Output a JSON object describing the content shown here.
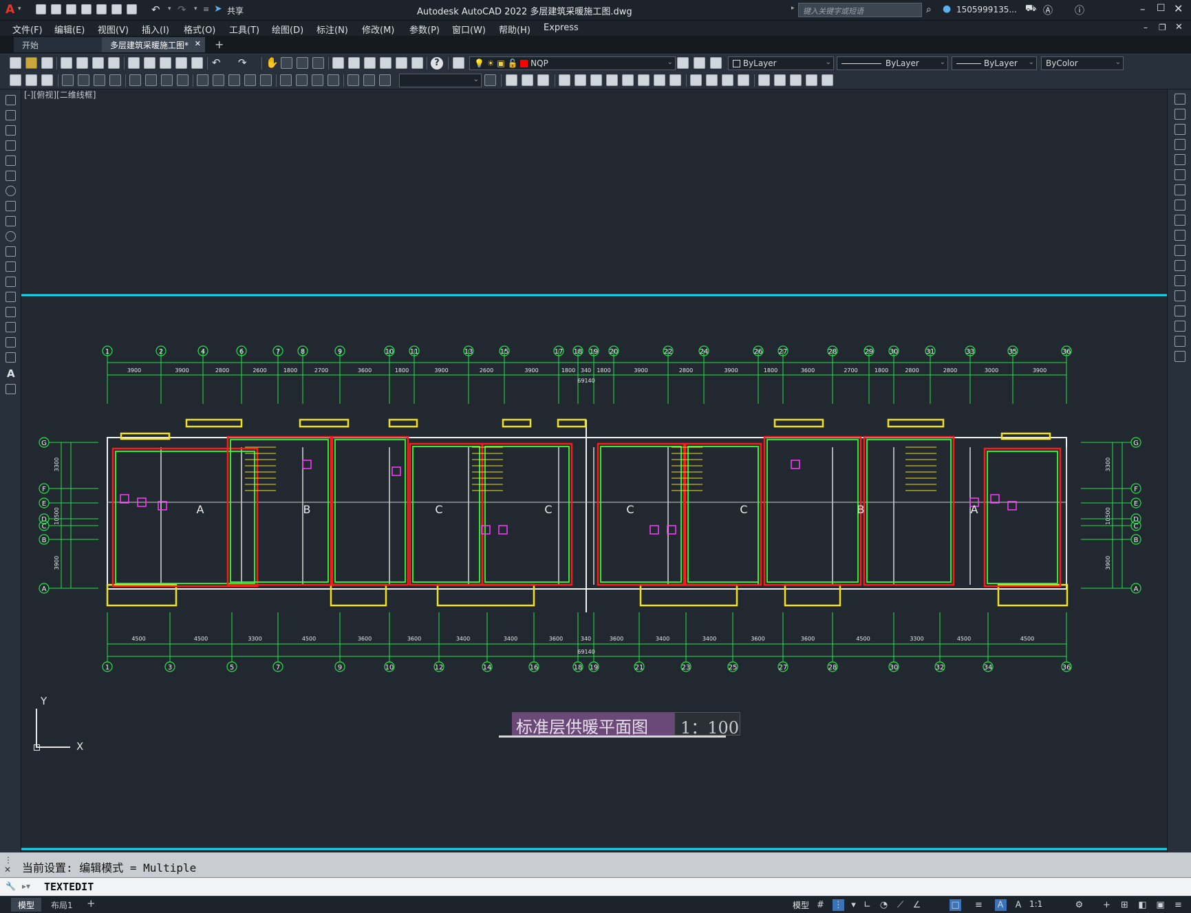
{
  "titlebar": {
    "app_logo": "A",
    "share_label": "共享",
    "title": "Autodesk AutoCAD 2022    多层建筑采暖施工图.dwg",
    "search_placeholder": "键入关键字或短语",
    "user": "1505999135...",
    "icons": [
      "new-icon",
      "open-icon",
      "save-icon",
      "saveas-icon",
      "publish-icon",
      "plot-icon",
      "undo-icon",
      "redo-icon",
      "share-icon",
      "search-icon",
      "user-icon",
      "cart-icon",
      "autodesk-app-icon",
      "help-icon",
      "minimize-icon",
      "maximize-icon",
      "close-icon"
    ]
  },
  "menu": [
    {
      "label": "文件(F)"
    },
    {
      "label": "编辑(E)"
    },
    {
      "label": "视图(V)"
    },
    {
      "label": "插入(I)"
    },
    {
      "label": "格式(O)"
    },
    {
      "label": "工具(T)"
    },
    {
      "label": "绘图(D)"
    },
    {
      "label": "标注(N)"
    },
    {
      "label": "修改(M)"
    },
    {
      "label": "参数(P)"
    },
    {
      "label": "窗口(W)"
    },
    {
      "label": "帮助(H)"
    },
    {
      "label": "Express"
    }
  ],
  "tabs": [
    {
      "label": "开始",
      "active": false
    },
    {
      "label": "多层建筑采暖施工图*",
      "active": true
    }
  ],
  "layer_combo": "NQP",
  "color_combo": "ByLayer",
  "linetype_combo": "ByLayer",
  "lineweight_combo": "ByLayer",
  "plotstyle_combo": "ByColor",
  "viewport_label": "[-][俯视][二维线框]",
  "drawing": {
    "top_axes": [
      "1",
      "2",
      "4",
      "6",
      "7",
      "8",
      "9",
      "10",
      "11",
      "13",
      "15",
      "17",
      "18",
      "19",
      "20",
      "22",
      "24",
      "26",
      "27",
      "28",
      "29",
      "30",
      "31",
      "33",
      "35",
      "36"
    ],
    "top_dims": [
      "3900",
      "3900",
      "2800",
      "2600",
      "1800",
      "2700",
      "3600",
      "1800",
      "3900",
      "2600",
      "3900",
      "1800",
      "340",
      "1800",
      "3900",
      "2800",
      "3900",
      "1800",
      "3600",
      "2700",
      "1800",
      "2800",
      "2800",
      "3000",
      "3900"
    ],
    "top_total": "69140",
    "bottom_axes": [
      "1",
      "3",
      "5",
      "7",
      "9",
      "10",
      "12",
      "14",
      "16",
      "18",
      "19",
      "21",
      "23",
      "25",
      "27",
      "28",
      "30",
      "32",
      "34",
      "36"
    ],
    "bottom_dims": [
      "4500",
      "4500",
      "3300",
      "4500",
      "3600",
      "3600",
      "3400",
      "3400",
      "3600",
      "340",
      "3600",
      "3400",
      "3400",
      "3600",
      "3600",
      "4500",
      "3300",
      "4500",
      "4500"
    ],
    "bottom_total": "69140",
    "row_axes": [
      "G",
      "F",
      "E",
      "D",
      "C",
      "B",
      "A"
    ],
    "left_dims": [
      "3300",
      "10500",
      "3900"
    ],
    "units": [
      "A",
      "B",
      "C",
      "C",
      "C",
      "C",
      "B",
      "A"
    ],
    "plan_title": "标准层供暖平面图",
    "plan_scale": "1：100"
  },
  "ucs": {
    "x": "X",
    "y": "Y"
  },
  "command_history": "当前设置: 编辑模式 = Multiple",
  "command_line": "TEXTEDIT",
  "layout_tabs": [
    {
      "label": "模型"
    },
    {
      "label": "布局1"
    }
  ],
  "status": {
    "model": "模型",
    "scale": "1:1"
  }
}
